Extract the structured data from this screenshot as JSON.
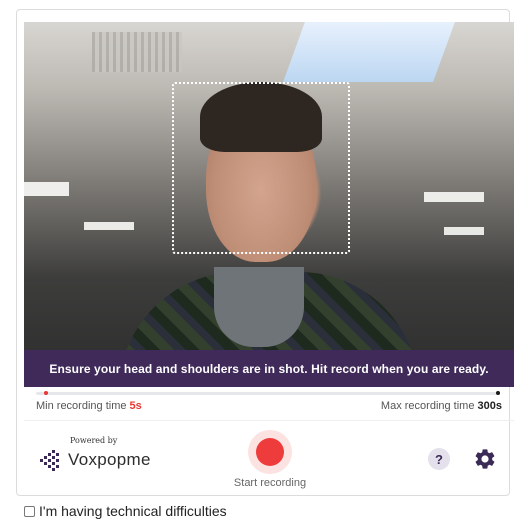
{
  "instruction_text": "Ensure your head and shoulders are in shot. Hit record when you are ready.",
  "recording": {
    "min_label": "Min recording time ",
    "min_value": "5s",
    "max_label": "Max recording time ",
    "max_value": "300s"
  },
  "branding": {
    "powered_by": "Powered by",
    "name": "Voxpopme"
  },
  "controls": {
    "record_label": "Start recording",
    "help_symbol": "?",
    "settings_icon": "gear-icon"
  },
  "technical_difficulties": {
    "label": "I'm having technical difficulties",
    "checked": false
  },
  "colors": {
    "banner_bg": "#3f2a5a",
    "record_red": "#ee3b3b",
    "min_marker": "#e53935"
  }
}
